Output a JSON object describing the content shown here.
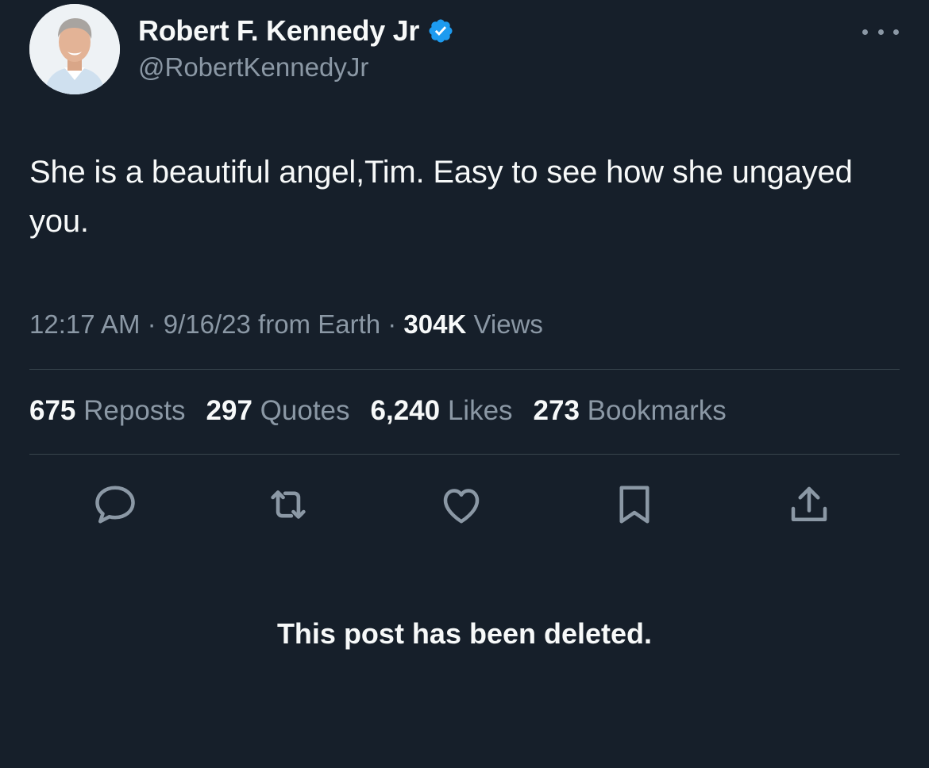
{
  "author": {
    "display_name": "Robert F. Kennedy Jr",
    "handle": "@RobertKennedyJr",
    "verified_color": "#1d9bf0"
  },
  "tweet": {
    "text": "She is a beautiful angel,Tim. Easy to see how she ungayed you."
  },
  "meta": {
    "time": "12:17 AM",
    "sep1": " · ",
    "date": "9/16/23",
    "source": " from Earth",
    "sep2": " · ",
    "views_count": "304K",
    "views_label": " Views"
  },
  "stats": [
    {
      "num": "675",
      "label": " Reposts"
    },
    {
      "num": "297",
      "label": " Quotes"
    },
    {
      "num": "6,240",
      "label": " Likes"
    },
    {
      "num": "273",
      "label": " Bookmarks"
    }
  ],
  "actions": [
    "reply-icon",
    "repost-icon",
    "like-icon",
    "bookmark-icon",
    "share-icon"
  ],
  "notice": "This post has been deleted.",
  "colors": {
    "background": "#161f2a",
    "text_primary": "#f7f9f9",
    "text_secondary": "#8b98a5",
    "divider": "#38444d",
    "icon": "#8b98a5"
  }
}
